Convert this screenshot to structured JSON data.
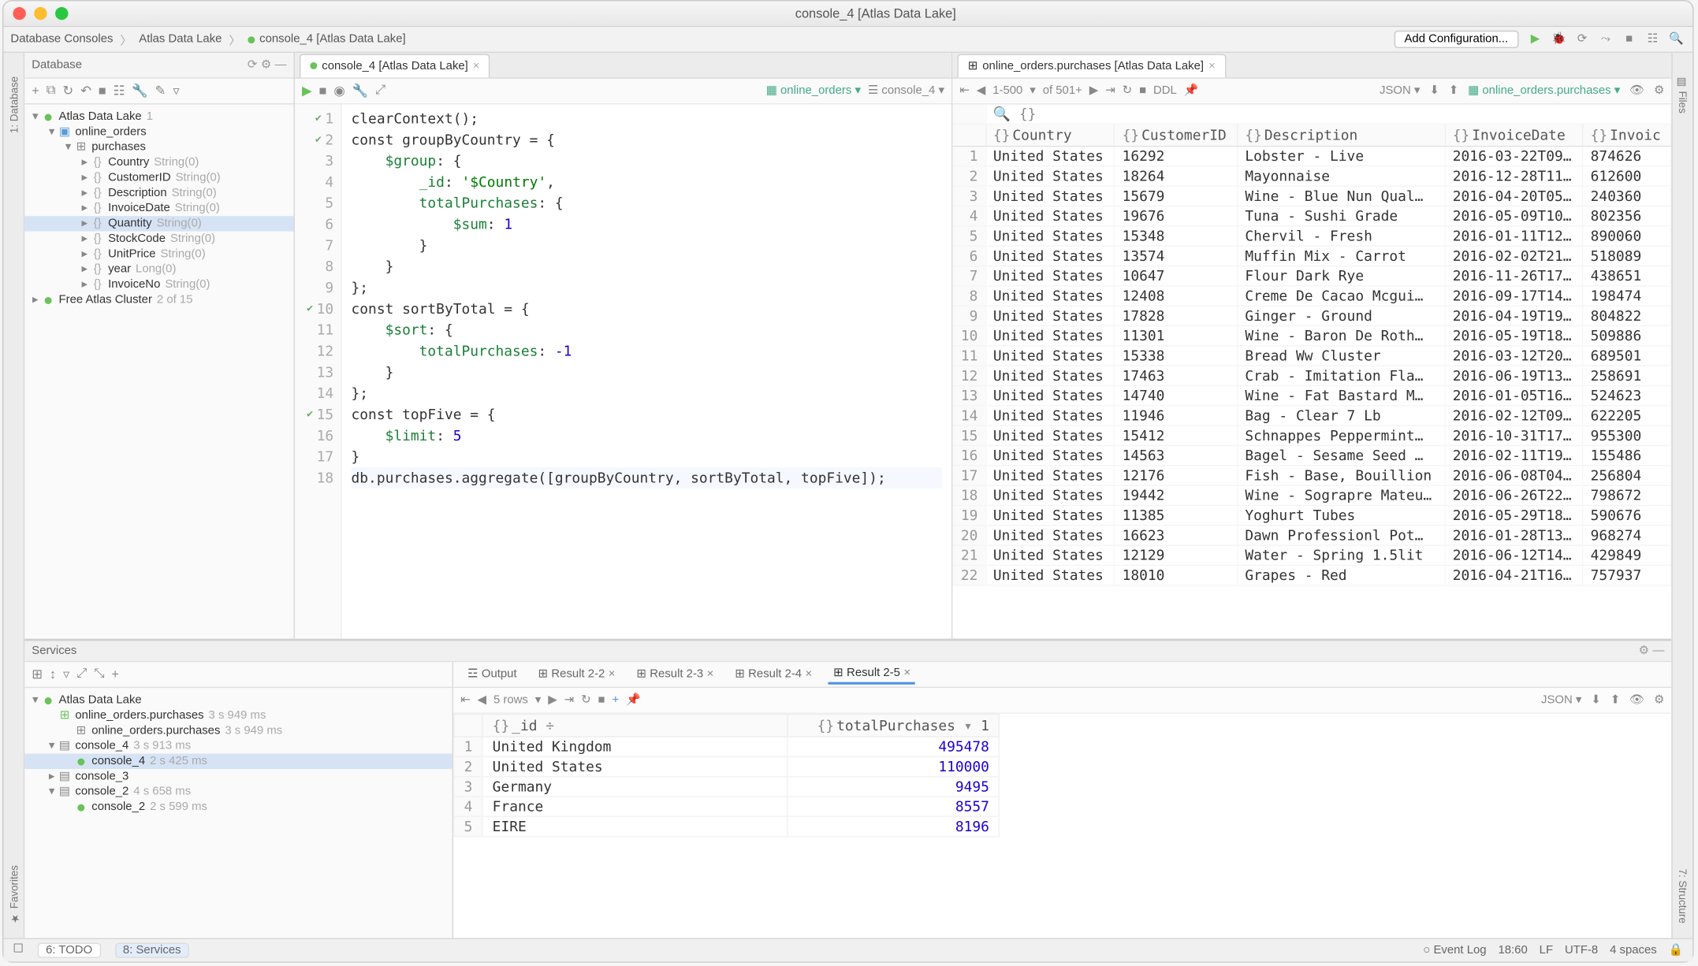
{
  "title": "console_4 [Atlas Data Lake]",
  "breadcrumbs": [
    "Database Consoles",
    "Atlas Data Lake",
    "console_4 [Atlas Data Lake]"
  ],
  "add_config_label": "Add Configuration...",
  "db_panel": {
    "title": "Database",
    "toolbar_icons": [
      "plus-icon",
      "refresh-icon",
      "revert-icon",
      "stop-icon",
      "vsplit-icon",
      "wrench-icon",
      "edit-icon",
      "filter-icon"
    ],
    "tree": [
      {
        "d": 0,
        "exp": "▾",
        "glyph": "db-green",
        "label": "Atlas Data Lake",
        "meta": "1"
      },
      {
        "d": 1,
        "exp": "▾",
        "glyph": "folder",
        "label": "online_orders",
        "meta": ""
      },
      {
        "d": 2,
        "exp": "▾",
        "glyph": "table",
        "label": "purchases",
        "meta": ""
      },
      {
        "d": 3,
        "exp": "▸",
        "glyph": "field",
        "label": "Country",
        "meta": "String(0)"
      },
      {
        "d": 3,
        "exp": "▸",
        "glyph": "field",
        "label": "CustomerID",
        "meta": "String(0)"
      },
      {
        "d": 3,
        "exp": "▸",
        "glyph": "field",
        "label": "Description",
        "meta": "String(0)"
      },
      {
        "d": 3,
        "exp": "▸",
        "glyph": "field",
        "label": "InvoiceDate",
        "meta": "String(0)"
      },
      {
        "d": 3,
        "exp": "▸",
        "glyph": "field",
        "label": "Quantity",
        "meta": "String(0)",
        "sel": true
      },
      {
        "d": 3,
        "exp": "▸",
        "glyph": "field",
        "label": "StockCode",
        "meta": "String(0)"
      },
      {
        "d": 3,
        "exp": "▸",
        "glyph": "field",
        "label": "UnitPrice",
        "meta": "String(0)"
      },
      {
        "d": 3,
        "exp": "▸",
        "glyph": "field",
        "label": "year",
        "meta": "Long(0)"
      },
      {
        "d": 3,
        "exp": "▸",
        "glyph": "field",
        "label": "InvoiceNo",
        "meta": "String(0)"
      },
      {
        "d": 0,
        "exp": "▸",
        "glyph": "db-green",
        "label": "Free Atlas Cluster",
        "meta": "2 of 15"
      }
    ]
  },
  "editor": {
    "tab_label": "console_4 [Atlas Data Lake]",
    "source_left": "online_orders",
    "source_right": "console_4",
    "lines": [
      {
        "n": 1,
        "chk": true,
        "raw": "clearContext();"
      },
      {
        "n": 2,
        "chk": true,
        "raw": "const groupByCountry = {"
      },
      {
        "n": 3,
        "raw": "    $group: {"
      },
      {
        "n": 4,
        "raw": "        _id: '$Country',"
      },
      {
        "n": 5,
        "raw": "        totalPurchases: {"
      },
      {
        "n": 6,
        "raw": "            $sum: 1"
      },
      {
        "n": 7,
        "raw": "        }"
      },
      {
        "n": 8,
        "raw": "    }"
      },
      {
        "n": 9,
        "raw": "};"
      },
      {
        "n": 10,
        "chk": true,
        "raw": "const sortByTotal = {"
      },
      {
        "n": 11,
        "raw": "    $sort: {"
      },
      {
        "n": 12,
        "raw": "        totalPurchases: -1"
      },
      {
        "n": 13,
        "raw": "    }"
      },
      {
        "n": 14,
        "raw": "};"
      },
      {
        "n": 15,
        "chk": true,
        "raw": "const topFive = {"
      },
      {
        "n": 16,
        "raw": "    $limit: 5"
      },
      {
        "n": 17,
        "raw": "}"
      },
      {
        "n": 18,
        "raw": "db.purchases.aggregate([groupByCountry, sortByTotal, topFive]);",
        "cursor": true
      }
    ]
  },
  "results_tab_label": "online_orders.purchases [Atlas Data Lake]",
  "results": {
    "paging": "1-500",
    "paging_total": "of 501+",
    "ddl_label": "DDL",
    "json_label": "JSON",
    "src_label": "online_orders.purchases",
    "columns": [
      "Country",
      "CustomerID",
      "Description",
      "InvoiceDate",
      "Invoic"
    ],
    "rows": [
      [
        "United States",
        "16292",
        "Lobster - Live",
        "2016-03-22T09…",
        "874626"
      ],
      [
        "United States",
        "18264",
        "Mayonnaise",
        "2016-12-28T11…",
        "612600"
      ],
      [
        "United States",
        "15679",
        "Wine - Blue Nun Qual…",
        "2016-04-20T05…",
        "240360"
      ],
      [
        "United States",
        "19676",
        "Tuna - Sushi Grade",
        "2016-05-09T10…",
        "802356"
      ],
      [
        "United States",
        "15348",
        "Chervil - Fresh",
        "2016-01-11T12…",
        "890060"
      ],
      [
        "United States",
        "13574",
        "Muffin Mix - Carrot",
        "2016-02-02T21…",
        "518089"
      ],
      [
        "United States",
        "10647",
        "Flour Dark Rye",
        "2016-11-26T17…",
        "438651"
      ],
      [
        "United States",
        "12408",
        "Creme De Cacao Mcgui…",
        "2016-09-17T14…",
        "198474"
      ],
      [
        "United States",
        "17828",
        "Ginger - Ground",
        "2016-04-19T19…",
        "804822"
      ],
      [
        "United States",
        "11301",
        "Wine - Baron De Roth…",
        "2016-05-19T18…",
        "509886"
      ],
      [
        "United States",
        "15338",
        "Bread Ww Cluster",
        "2016-03-12T20…",
        "689501"
      ],
      [
        "United States",
        "17463",
        "Crab - Imitation Fla…",
        "2016-06-19T13…",
        "258691"
      ],
      [
        "United States",
        "14740",
        "Wine - Fat Bastard M…",
        "2016-01-05T16…",
        "524623"
      ],
      [
        "United States",
        "11946",
        "Bag - Clear 7 Lb",
        "2016-02-12T09…",
        "622205"
      ],
      [
        "United States",
        "15412",
        "Schnappes Peppermint…",
        "2016-10-31T17…",
        "955300"
      ],
      [
        "United States",
        "14563",
        "Bagel - Sesame Seed …",
        "2016-02-11T19…",
        "155486"
      ],
      [
        "United States",
        "12176",
        "Fish - Base, Bouillion",
        "2016-06-08T04…",
        "256804"
      ],
      [
        "United States",
        "19442",
        "Wine - Sograpre Mateu…",
        "2016-06-26T22…",
        "798672"
      ],
      [
        "United States",
        "11385",
        "Yoghurt Tubes",
        "2016-05-29T18…",
        "590676"
      ],
      [
        "United States",
        "16623",
        "Dawn Professionl Pot…",
        "2016-01-28T13…",
        "968274"
      ],
      [
        "United States",
        "12129",
        "Water - Spring 1.5lit",
        "2016-06-12T14…",
        "429849"
      ],
      [
        "United States",
        "18010",
        "Grapes - Red",
        "2016-04-21T16…",
        "757937"
      ]
    ]
  },
  "services": {
    "title": "Services",
    "tree": [
      {
        "d": 0,
        "exp": "▾",
        "glyph": "db-green",
        "label": "Atlas Data Lake",
        "meta": ""
      },
      {
        "d": 1,
        "exp": " ",
        "glyph": "table-g",
        "label": "online_orders.purchases",
        "meta": "3 s 949 ms"
      },
      {
        "d": 2,
        "exp": " ",
        "glyph": "table",
        "label": "online_orders.purchases",
        "meta": "3 s 949 ms"
      },
      {
        "d": 1,
        "exp": "▾",
        "glyph": "console",
        "label": "console_4",
        "meta": "3 s 913 ms"
      },
      {
        "d": 2,
        "exp": " ",
        "glyph": "console-g",
        "label": "console_4",
        "meta": "2 s 425 ms",
        "sel": true
      },
      {
        "d": 1,
        "exp": "▸",
        "glyph": "console",
        "label": "console_3",
        "meta": ""
      },
      {
        "d": 1,
        "exp": "▾",
        "glyph": "console",
        "label": "console_2",
        "meta": "4 s 658 ms"
      },
      {
        "d": 2,
        "exp": " ",
        "glyph": "console-g",
        "label": "console_2",
        "meta": "2 s 599 ms"
      }
    ],
    "tabs": [
      "Output",
      "Result 2-2",
      "Result 2-3",
      "Result 2-4",
      "Result 2-5"
    ],
    "active_tab": 4,
    "rows_label": "5 rows",
    "json_label": "JSON",
    "grid": {
      "columns": [
        "_id",
        "totalPurchases",
        "1"
      ],
      "rows": [
        [
          "United Kingdom",
          "495478"
        ],
        [
          "United States",
          "110000"
        ],
        [
          "Germany",
          "9495"
        ],
        [
          "France",
          "8557"
        ],
        [
          "EIRE",
          "8196"
        ]
      ]
    }
  },
  "statusbar": {
    "left": [
      "6: TODO",
      "8: Services"
    ],
    "event_log": "Event Log",
    "right": [
      "18:60",
      "LF",
      "UTF-8",
      "4 spaces"
    ]
  }
}
